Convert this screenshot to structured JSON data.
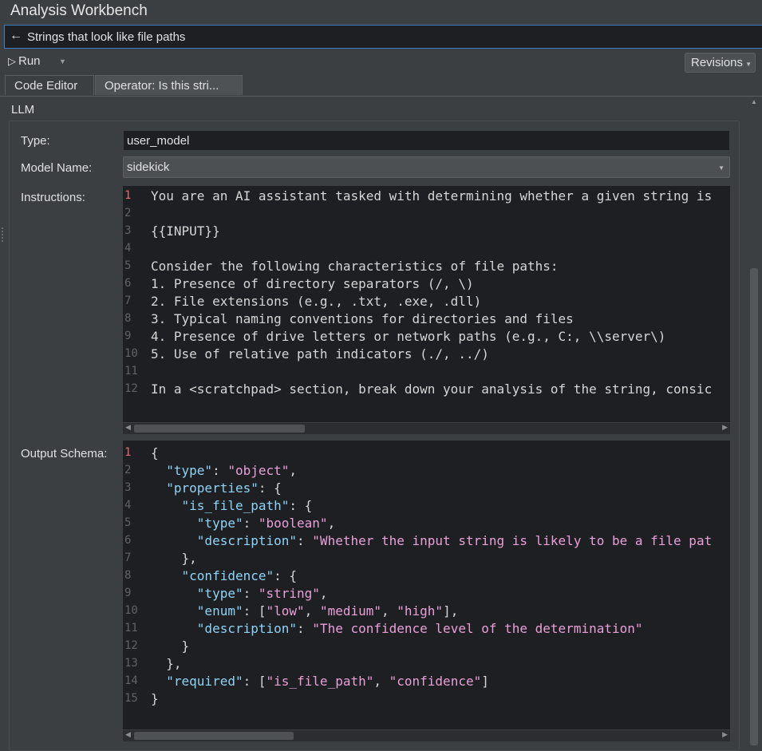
{
  "window": {
    "title": "Analysis Workbench"
  },
  "search": {
    "back_icon": "arrow-left-icon",
    "value": "Strings that look like file paths"
  },
  "toolbar": {
    "run_label": "Run",
    "revisions_label": "Revisions"
  },
  "tabs": [
    {
      "label": "Code Editor",
      "active": false
    },
    {
      "label": "Operator: Is this stri...",
      "active": true
    }
  ],
  "section": {
    "title": "LLM"
  },
  "form": {
    "type_label": "Type:",
    "type_value": "user_model",
    "model_label": "Model Name:",
    "model_value": "sidekick",
    "instructions_label": "Instructions:",
    "schema_label": "Output Schema:"
  },
  "instructions": {
    "lines": [
      "You are an AI assistant tasked with determining whether a given string is",
      "",
      "{{INPUT}}",
      "",
      "Consider the following characteristics of file paths:",
      "1. Presence of directory separators (/, \\)",
      "2. File extensions (e.g., .txt, .exe, .dll)",
      "3. Typical naming conventions for directories and files",
      "4. Presence of drive letters or network paths (e.g., C:, \\\\server\\)",
      "5. Use of relative path indicators (./, ../)",
      "",
      "In a <scratchpad> section, break down your analysis of the string, consic"
    ]
  },
  "schema": {
    "line_numbers": [
      "1",
      "2",
      "3",
      "4",
      "5",
      "6",
      "7",
      "8",
      "9",
      "10",
      "11",
      "12",
      "13",
      "14",
      "15"
    ],
    "l1": "{",
    "type_key": "\"type\"",
    "object_val": "\"object\"",
    "properties_key": "\"properties\"",
    "is_file_path_key": "\"is_file_path\"",
    "boolean_val": "\"boolean\"",
    "description_key": "\"description\"",
    "desc1_val": "\"Whether the input string is likely to be a file pat",
    "confidence_key": "\"confidence\"",
    "string_val": "\"string\"",
    "enum_key": "\"enum\"",
    "low_val": "\"low\"",
    "medium_val": "\"medium\"",
    "high_val": "\"high\"",
    "desc2_val": "\"The confidence level of the determination\"",
    "required_key": "\"required\"",
    "req1_val": "\"is_file_path\"",
    "req2_val": "\"confidence\"",
    "close": "}"
  }
}
